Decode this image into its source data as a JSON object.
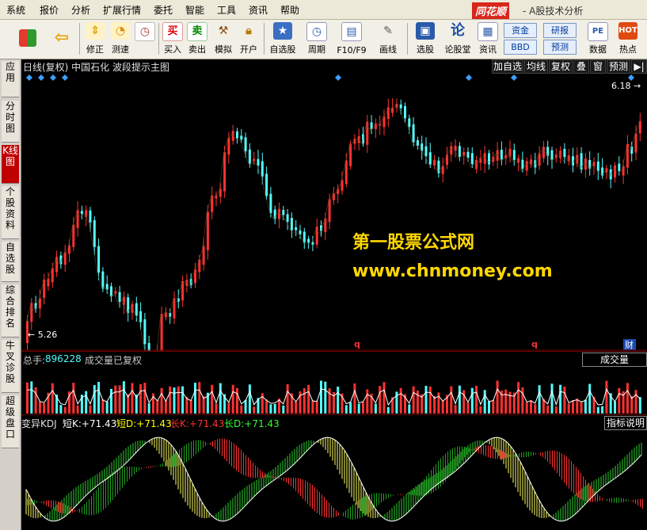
{
  "menu": [
    "系统",
    "报价",
    "分析",
    "扩展行情",
    "委托",
    "智能",
    "工具",
    "资讯",
    "帮助"
  ],
  "brand": {
    "logo": "同花顺",
    "title": "- A股技术分析"
  },
  "toolbar": {
    "buttons": [
      {
        "label": "",
        "icon": "grid-icon"
      },
      {
        "label": "",
        "icon": "back-arrow-icon"
      },
      {
        "label": "修正",
        "icon": "up-down-arrows-icon"
      },
      {
        "label": "测速",
        "icon": "speed-icon"
      },
      {
        "label": "买入",
        "icon": "buy-icon",
        "glyph": "买"
      },
      {
        "label": "卖出",
        "icon": "sell-icon",
        "glyph": "卖"
      },
      {
        "label": "模拟",
        "icon": "hammer-icon"
      },
      {
        "label": "开户",
        "icon": "lock-icon"
      },
      {
        "label": "自选股",
        "icon": "star-folder-icon"
      },
      {
        "label": "周期",
        "icon": "clock-icon"
      },
      {
        "label": "F10/F9",
        "icon": "document-icon"
      },
      {
        "label": "画线",
        "icon": "pencil-icon"
      },
      {
        "label": "选股",
        "icon": "select-stock-icon"
      },
      {
        "label": "论股堂",
        "icon": "forum-icon",
        "glyph": "论"
      },
      {
        "label": "资讯",
        "icon": "info-icon"
      },
      {
        "label": "数据",
        "icon": "pe-icon"
      },
      {
        "label": "热点",
        "icon": "hot-icon"
      }
    ],
    "boxes": [
      "资金",
      "研报",
      "BBD",
      "预测"
    ]
  },
  "sidebar": [
    "应用",
    "分时图",
    "K线图",
    "个股资料",
    "自选股",
    "综合排名",
    "牛叉诊股",
    "超级盘口"
  ],
  "chart": {
    "header": "日线(复权) 中国石化 波段提示主图",
    "right_buttons": [
      "加自选",
      "均线",
      "复权",
      "叠",
      "窗",
      "预测",
      "▶|"
    ],
    "high_label": "6.18",
    "low_label": "5.26",
    "q_markers": [
      "q",
      "q"
    ],
    "cai_marker": "财",
    "watermark_cn": "第一股票公式网",
    "watermark_url": "www.chnmoney.com"
  },
  "volume": {
    "total_label": "总手:",
    "total_value": "896228",
    "note": "成交量已复权",
    "button": "成交量"
  },
  "kdj": {
    "name": "变异KDJ",
    "fields": [
      {
        "label": "短K:",
        "value": "+71.43",
        "color": "#ffffff"
      },
      {
        "label": "短D:",
        "value": "+71.43",
        "color": "#ffff00"
      },
      {
        "label": "长K:",
        "value": "+71.43",
        "color": "#ff3030"
      },
      {
        "label": "长D:",
        "value": "+71.43",
        "color": "#30ff30"
      }
    ],
    "button": "指标说明"
  },
  "colors": {
    "up": "#ff3232",
    "down": "#54fcfc",
    "ma": "#ffffff",
    "diamond": "#3ba0ff"
  },
  "chart_data": {
    "type": "candlestick",
    "title": "日线(复权) 中国石化 波段提示主图",
    "y_range": [
      5.26,
      6.18
    ],
    "high": 6.18,
    "low": 5.26,
    "volume_total": 896228,
    "kdj_values": {
      "short_k": 71.43,
      "short_d": 71.43,
      "long_k": 71.43,
      "long_d": 71.43
    }
  }
}
